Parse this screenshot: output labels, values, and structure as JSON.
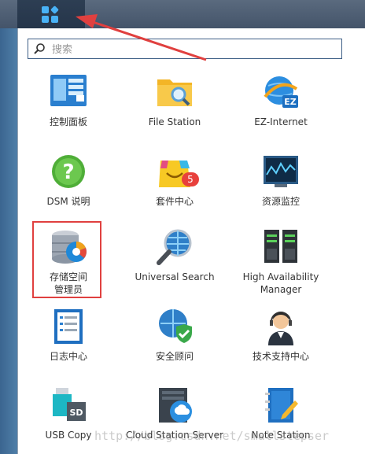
{
  "search": {
    "placeholder": "搜索"
  },
  "apps": [
    {
      "label": "控制面板"
    },
    {
      "label": "File Station"
    },
    {
      "label": "EZ-Internet"
    },
    {
      "label": "DSM 说明"
    },
    {
      "label": "套件中心",
      "badge": "5"
    },
    {
      "label": "资源监控"
    },
    {
      "label": "存储空间\n管理员"
    },
    {
      "label": "Universal Search"
    },
    {
      "label": "High Availability\nManager"
    },
    {
      "label": "日志中心"
    },
    {
      "label": "安全顾问"
    },
    {
      "label": "技术支持中心"
    },
    {
      "label": "USB Copy"
    },
    {
      "label": "Cloud Station Server"
    },
    {
      "label": "Note Station"
    }
  ],
  "watermark": "http://blog.csdn.net/smallstepser",
  "colors": {
    "accent": "#49b2f6",
    "highlight": "#e0403f"
  }
}
